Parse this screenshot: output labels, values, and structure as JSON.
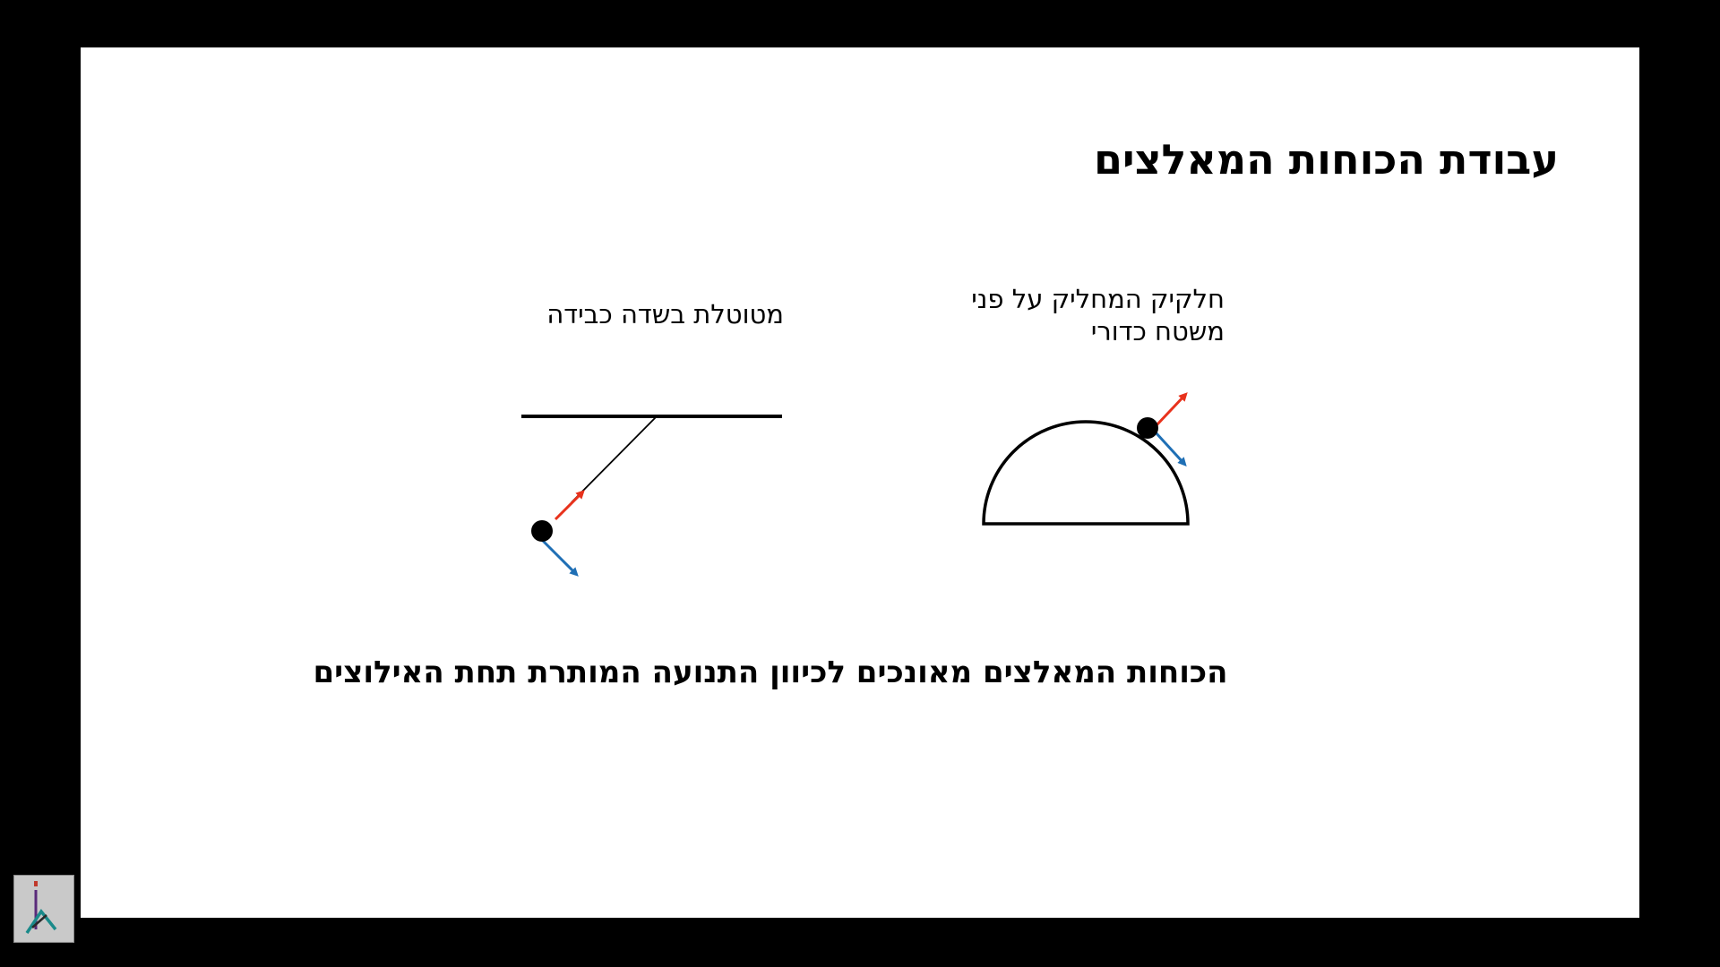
{
  "slide": {
    "title": "עבודת הכוחות המאלצים",
    "pendulum_label": "מטוטלת בשדה כבידה",
    "particle_label": "חלקיק המחליק על פני משטח כדורי",
    "conclusion": "הכוחות המאלצים מאונכים לכיוון התנועה המותרת תחת האילוצים"
  },
  "colors": {
    "constraint_force": "#e8321c",
    "allowed_motion": "#1f6fb5",
    "ink": "#000000"
  },
  "icons": {
    "corner_logo": "broadcaster-logo-icon"
  }
}
